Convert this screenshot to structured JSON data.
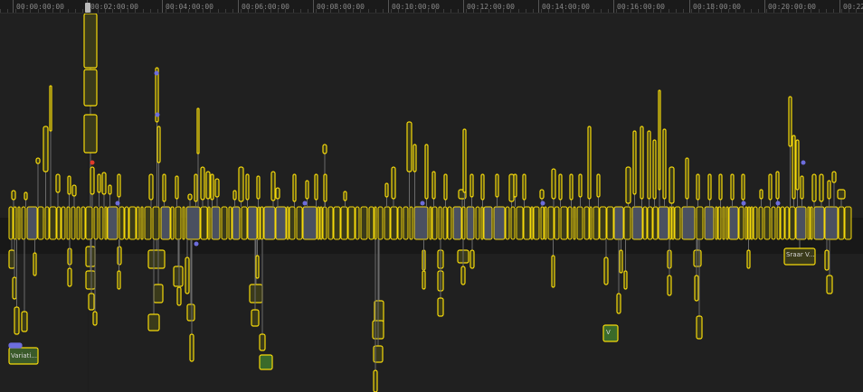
{
  "ruler": {
    "timecodes": [
      "00:00:00:00",
      "00:02:00:00",
      "00:04:00:00",
      "00:06:00:00",
      "00:08:00:00",
      "00:10:00:00",
      "00:12:00:00",
      "00:14:00:00",
      "00:16:00:00",
      "00:18:00:00",
      "00:20:00:00",
      "00:22"
    ]
  },
  "clip_labels": {
    "variation": "Variati...",
    "right_clip": "Sraar V...",
    "v_clip": "V"
  },
  "colors": {
    "background": "#202020",
    "clip_border": "#f5d90a",
    "clip_fill": "#3a3a1a",
    "connection_line": "#6a6a6a",
    "marker": "#6d6ddd",
    "marker_red": "#e03a2a",
    "green_clip": "#5aa83a"
  }
}
